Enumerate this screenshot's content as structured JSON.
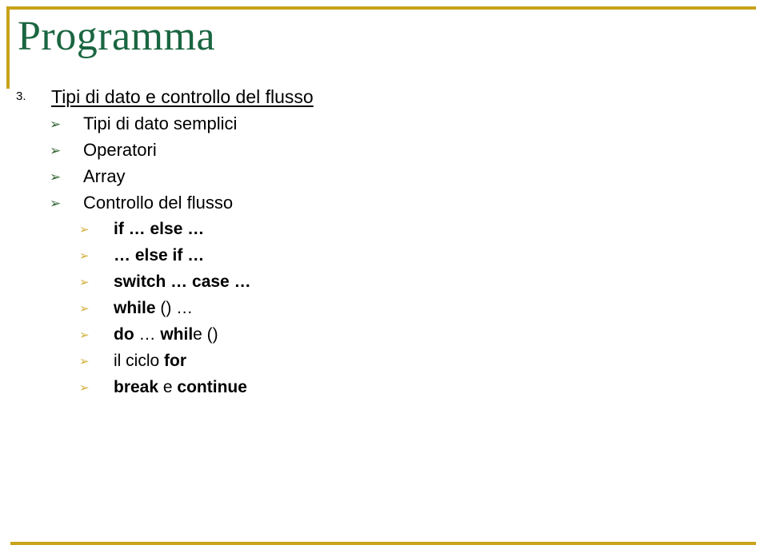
{
  "slide": {
    "title": "Programma",
    "title_color": "#1a6641",
    "accent_color": "#c9a21a",
    "background_color": "#ffffff",
    "bullet_level2_color": "#336633",
    "bullet_level3_color": "#d2b13c",
    "bullet_glyph": "➢"
  },
  "outline": {
    "level1": {
      "number": "3.",
      "text": "Tipi di dato e controllo del flusso",
      "underlined": true
    },
    "level2": [
      {
        "text": "Tipi di dato semplici"
      },
      {
        "text": "Operatori"
      },
      {
        "text": "Array"
      },
      {
        "text": "Controllo del flusso"
      }
    ],
    "level3": [
      {
        "text": "if … else …",
        "bold_part": "if … else …",
        "regular_part": ""
      },
      {
        "text": "… else if …",
        "bold_part": "… else if …",
        "regular_part": ""
      },
      {
        "text": "switch … case …",
        "bold_part": "switch … case …",
        "regular_part": ""
      },
      {
        "text": "while () …",
        "bold_part": "while",
        "regular_part": " () …"
      },
      {
        "text": "do … while ()",
        "bold_part": "do",
        "mid_regular": " … ",
        "bold_part2": "whil",
        "regular_part": "e ()"
      },
      {
        "text": "il ciclo for",
        "regular_lead": "il ciclo ",
        "bold_part": "for"
      },
      {
        "text": "break e continue",
        "bold_part": "break",
        "mid_regular": " e ",
        "bold_part2": "continue"
      }
    ]
  }
}
